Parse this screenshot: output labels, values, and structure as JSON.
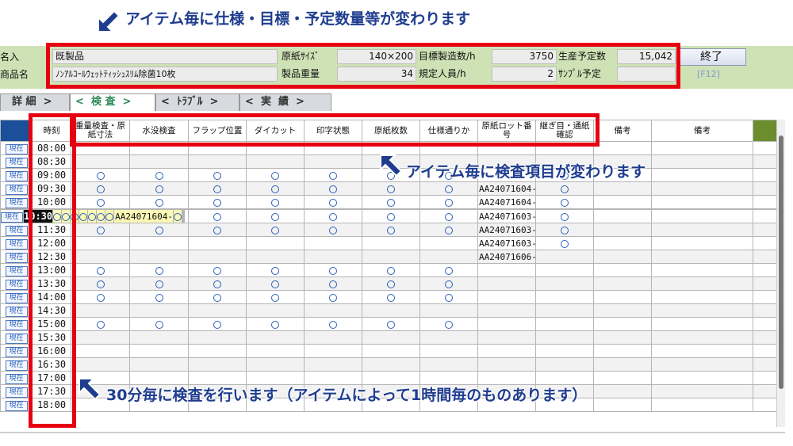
{
  "annotations": {
    "top": "アイテム毎に仕様・目標・予定数量等が変わります",
    "middle": "アイテム毎に検査項目が変わります",
    "bottom": "30分毎に検査を行います（アイテムによって1時間毎のものあります）"
  },
  "header": {
    "label1": "名入",
    "label2": "商品名",
    "field1": "既製品",
    "field2": "ﾉﾝｱﾙｺｰﾙｳｪｯﾄﾃｨｯｼｭｽﾘﾑ除菌10枚",
    "paper_size_label": "原紙ｻｲｽﾞ",
    "paper_size_value": "140×200",
    "target_label": "目標製造数/h",
    "target_value": "3750",
    "planned_label": "生産予定数",
    "planned_value": "15,042",
    "weight_label": "製品重量",
    "weight_value": "34",
    "staff_label": "規定人員/h",
    "staff_value": "2",
    "sample_label": "ｻﾝﾌﾟﾙ予定",
    "sample_value": "",
    "end_button": "終了",
    "f12": "[F12]"
  },
  "tabs": [
    {
      "label": "詳 細  >"
    },
    {
      "label": "<  検 査  >"
    },
    {
      "label": "<  ﾄﾗﾌﾞﾙ  >"
    },
    {
      "label": "<  実  績  >"
    }
  ],
  "table": {
    "headers": [
      "時刻",
      "重量検査・原紙寸法",
      "水没検査",
      "フラップ位置",
      "ダイカット",
      "印字状態",
      "原紙枚数",
      "仕様通りか",
      "原紙ロット番号",
      "継ぎ目・通紙確認",
      "備考",
      "備考"
    ],
    "now_label": "現在",
    "ok_mark": "○",
    "highlight_row": 5,
    "rows": [
      {
        "time": "08:00",
        "checks": [
          false,
          false,
          false,
          false,
          false,
          false,
          false
        ],
        "lot": "",
        "seam": false
      },
      {
        "time": "08:30",
        "checks": [
          false,
          false,
          false,
          false,
          false,
          false,
          false
        ],
        "lot": "",
        "seam": false
      },
      {
        "time": "09:00",
        "checks": [
          true,
          true,
          true,
          true,
          true,
          true,
          true
        ],
        "lot": "",
        "seam": true
      },
      {
        "time": "09:30",
        "checks": [
          true,
          true,
          true,
          true,
          true,
          true,
          true
        ],
        "lot": "AA24071604-",
        "seam": true
      },
      {
        "time": "10:00",
        "checks": [
          true,
          true,
          true,
          true,
          true,
          true,
          true
        ],
        "lot": "AA24071604-",
        "seam": true
      },
      {
        "time": "10:30",
        "checks": [
          true,
          true,
          true,
          true,
          true,
          true,
          true
        ],
        "lot": "AA24071604-",
        "seam": true
      },
      {
        "time": "11:00",
        "checks": [
          true,
          true,
          true,
          true,
          true,
          true,
          true
        ],
        "lot": "AA24071603-",
        "seam": true
      },
      {
        "time": "11:30",
        "checks": [
          true,
          true,
          true,
          true,
          true,
          true,
          true
        ],
        "lot": "AA24071603-",
        "seam": true
      },
      {
        "time": "12:00",
        "checks": [
          false,
          false,
          false,
          false,
          false,
          false,
          false
        ],
        "lot": "AA24071603-",
        "seam": true
      },
      {
        "time": "12:30",
        "checks": [
          false,
          false,
          false,
          false,
          false,
          false,
          false
        ],
        "lot": "AA24071606-",
        "seam": false
      },
      {
        "time": "13:00",
        "checks": [
          true,
          true,
          true,
          true,
          true,
          true,
          true
        ],
        "lot": "",
        "seam": false
      },
      {
        "time": "13:30",
        "checks": [
          true,
          true,
          true,
          true,
          true,
          true,
          true
        ],
        "lot": "",
        "seam": false
      },
      {
        "time": "14:00",
        "checks": [
          true,
          true,
          true,
          true,
          true,
          true,
          true
        ],
        "lot": "",
        "seam": false
      },
      {
        "time": "14:30",
        "checks": [
          false,
          false,
          false,
          false,
          false,
          false,
          false
        ],
        "lot": "",
        "seam": false
      },
      {
        "time": "15:00",
        "checks": [
          true,
          true,
          true,
          true,
          true,
          true,
          true
        ],
        "lot": "",
        "seam": false
      },
      {
        "time": "15:30",
        "checks": [
          false,
          false,
          false,
          false,
          false,
          false,
          false
        ],
        "lot": "",
        "seam": false
      },
      {
        "time": "16:00",
        "checks": [
          false,
          false,
          false,
          false,
          false,
          false,
          false
        ],
        "lot": "",
        "seam": false
      },
      {
        "time": "16:30",
        "checks": [
          false,
          false,
          false,
          false,
          false,
          false,
          false
        ],
        "lot": "",
        "seam": false
      },
      {
        "time": "17:00",
        "checks": [
          false,
          false,
          false,
          false,
          false,
          false,
          false
        ],
        "lot": "",
        "seam": false
      },
      {
        "time": "17:30",
        "checks": [
          false,
          false,
          false,
          false,
          false,
          false,
          false
        ],
        "lot": "",
        "seam": false
      },
      {
        "time": "18:00",
        "checks": [
          false,
          false,
          false,
          false,
          false,
          false,
          false
        ],
        "lot": "",
        "seam": false
      }
    ]
  },
  "colors": {
    "header_bg": "#cfe2b6",
    "annotation_red": "#e60012",
    "annotation_text": "#1f3d8f",
    "highlight_row": "#fbf8b6",
    "col_blue": "#1c4f9a",
    "col_green": "#6b8d2d"
  },
  "icons": {
    "arrow": "arrow-pointer-icon",
    "check": "circle-ok-icon"
  }
}
